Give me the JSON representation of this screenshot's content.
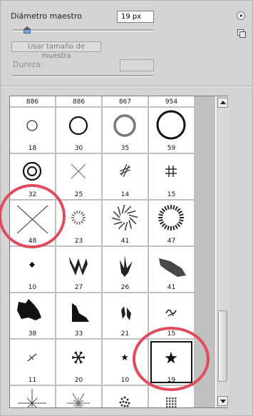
{
  "master_diameter": {
    "label": "Diámetro maestro",
    "value": "19 px",
    "slider_fraction": 0.1
  },
  "sample_size_button": "Usar tamaño de muestra",
  "hardness": {
    "label": "Dureza:",
    "value": ""
  },
  "panel_menu_icon": "circle-arrow-menu-icon",
  "new_preset_icon": "new-preset-icon",
  "brush_grid": {
    "columns": 4,
    "rows": [
      [
        {
          "size": "886",
          "shape": "partial"
        },
        {
          "size": "886",
          "shape": "partial"
        },
        {
          "size": "867",
          "shape": "partial"
        },
        {
          "size": "954",
          "shape": "partial"
        }
      ],
      [
        {
          "size": "18",
          "shape": "circle-small"
        },
        {
          "size": "30",
          "shape": "circle-medium"
        },
        {
          "size": "35",
          "shape": "circle-soft"
        },
        {
          "size": "59",
          "shape": "circle-large"
        }
      ],
      [
        {
          "size": "32",
          "shape": "double-ring"
        },
        {
          "size": "25",
          "shape": "cross-thin"
        },
        {
          "size": "14",
          "shape": "hatch-diagonal"
        },
        {
          "size": "15",
          "shape": "hatch-grid"
        }
      ],
      [
        {
          "size": "48",
          "shape": "cross-large"
        },
        {
          "size": "23",
          "shape": "dot-ring-small"
        },
        {
          "size": "41",
          "shape": "pinwheel"
        },
        {
          "size": "47",
          "shape": "dot-ring-large"
        }
      ],
      [
        {
          "size": "10",
          "shape": "diamond"
        },
        {
          "size": "27",
          "shape": "zigzag"
        },
        {
          "size": "26",
          "shape": "leaf-splash"
        },
        {
          "size": "41",
          "shape": "chalk-stroke"
        }
      ],
      [
        {
          "size": "38",
          "shape": "ink-blot"
        },
        {
          "size": "33",
          "shape": "wedge"
        },
        {
          "size": "21",
          "shape": "leaf-pair"
        },
        {
          "size": "15",
          "shape": "squiggle"
        }
      ],
      [
        {
          "size": "11",
          "shape": "slash"
        },
        {
          "size": "20",
          "shape": "snowflake"
        },
        {
          "size": "10",
          "shape": "star-small"
        },
        {
          "size": "19",
          "shape": "star"
        }
      ],
      [
        {
          "size": "",
          "shape": "starburst"
        },
        {
          "size": "",
          "shape": "starburst-soft"
        },
        {
          "size": "",
          "shape": "speckle"
        },
        {
          "size": "",
          "shape": "grid-dots"
        }
      ]
    ],
    "selected": {
      "row": 6,
      "col": 3
    }
  },
  "annotations": {
    "color": "#e24b5f",
    "circled": [
      "brush-48-cross",
      "brush-19-star"
    ]
  }
}
